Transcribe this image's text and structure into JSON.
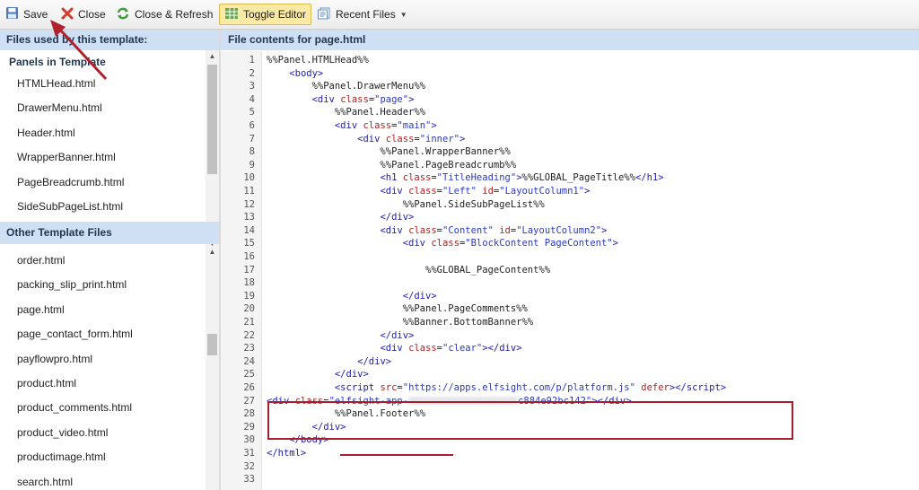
{
  "toolbar": {
    "save": "Save",
    "close": "Close",
    "close_refresh": "Close & Refresh",
    "toggle_editor": "Toggle Editor",
    "recent_files": "Recent Files"
  },
  "left": {
    "header": "Files used by this template:",
    "panels_title": "Panels in Template",
    "panels": [
      "HTMLHead.html",
      "DrawerMenu.html",
      "Header.html",
      "WrapperBanner.html",
      "PageBreadcrumb.html",
      "SideSubPageList.html"
    ],
    "other_header": "Other Template Files",
    "others": [
      "order.html",
      "packing_slip_print.html",
      "page.html",
      "page_contact_form.html",
      "payflowpro.html",
      "product.html",
      "product_comments.html",
      "product_video.html",
      "productimage.html",
      "search.html"
    ]
  },
  "right": {
    "header": "File contents for page.html"
  },
  "code": {
    "l1": "%%Panel.HTMLHead%%",
    "l2a": "    <",
    "l2b": "body",
    "l2c": ">",
    "l3": "        %%Panel.DrawerMenu%%",
    "l5": "            %%Panel.Header%%",
    "l8": "                    %%Panel.WrapperBanner%%",
    "l9": "                    %%Panel.PageBreadcrumb%%",
    "l12": "                        %%Panel.SideSubPageList%%",
    "l17": "                            %%GLOBAL_PageContent%%",
    "l20": "                        %%Panel.PageComments%%",
    "l21": "                        %%Banner.BottomBanner%%",
    "l28": "            %%Panel.Footer%%",
    "title_text": "%%GLOBAL_PageTitle%%",
    "script_src": "\"https://apps.elfsight.com/p/platform.js\"",
    "defer": "defer",
    "elf_class_start": "\"elfsight-app-",
    "elf_class_end": "c884e92bc142\"",
    "line_count": 33
  }
}
